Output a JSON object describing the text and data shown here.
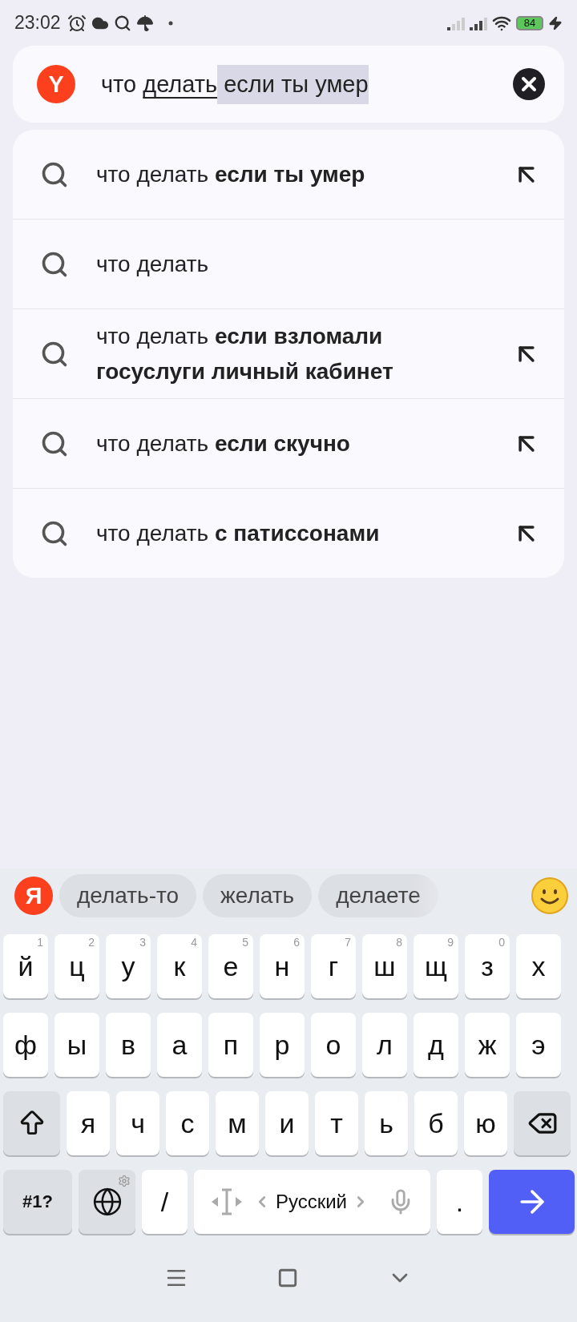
{
  "status_bar": {
    "time": "23:02",
    "battery": "84",
    "charging": true
  },
  "search": {
    "logo": "Y",
    "segments": [
      {
        "text": "что ",
        "underlined": false,
        "highlighted": false
      },
      {
        "text": "делать",
        "underlined": true,
        "highlighted": false
      },
      {
        "text": " если ты умер",
        "underlined": false,
        "highlighted": true
      }
    ]
  },
  "suggestions": [
    {
      "text": "что делать **если ты умер**",
      "insert_arrow": true
    },
    {
      "text": "что делать",
      "insert_arrow": false
    },
    {
      "text": "что делать **если взломали госуслуги личный кабинет**",
      "insert_arrow": true
    },
    {
      "text": "что делать **если скучно**",
      "insert_arrow": true
    },
    {
      "text": "что делать **с патиссонами**",
      "insert_arrow": true
    }
  ],
  "keyboard": {
    "logo": "Я",
    "candidates": [
      "делать-то",
      "желать",
      "делаете"
    ],
    "rows": [
      [
        {
          "kind": "letter",
          "label": "й",
          "hint": "1"
        },
        {
          "kind": "letter",
          "label": "ц",
          "hint": "2"
        },
        {
          "kind": "letter",
          "label": "у",
          "hint": "3"
        },
        {
          "kind": "letter",
          "label": "к",
          "hint": "4"
        },
        {
          "kind": "letter",
          "label": "е",
          "hint": "5"
        },
        {
          "kind": "letter",
          "label": "н",
          "hint": "6"
        },
        {
          "kind": "letter",
          "label": "г",
          "hint": "7"
        },
        {
          "kind": "letter",
          "label": "ш",
          "hint": "8"
        },
        {
          "kind": "letter",
          "label": "щ",
          "hint": "9"
        },
        {
          "kind": "letter",
          "label": "з",
          "hint": "0"
        },
        {
          "kind": "letter",
          "label": "х"
        }
      ],
      [
        {
          "kind": "letter",
          "label": "ф"
        },
        {
          "kind": "letter",
          "label": "ы"
        },
        {
          "kind": "letter",
          "label": "в"
        },
        {
          "kind": "letter",
          "label": "а"
        },
        {
          "kind": "letter",
          "label": "п"
        },
        {
          "kind": "letter",
          "label": "р"
        },
        {
          "kind": "letter",
          "label": "о"
        },
        {
          "kind": "letter",
          "label": "л"
        },
        {
          "kind": "letter",
          "label": "д"
        },
        {
          "kind": "letter",
          "label": "ж"
        },
        {
          "kind": "letter",
          "label": "э"
        }
      ],
      [
        {
          "kind": "shift"
        },
        {
          "kind": "letter",
          "label": "я"
        },
        {
          "kind": "letter",
          "label": "ч"
        },
        {
          "kind": "letter",
          "label": "с"
        },
        {
          "kind": "letter",
          "label": "м"
        },
        {
          "kind": "letter",
          "label": "и"
        },
        {
          "kind": "letter",
          "label": "т"
        },
        {
          "kind": "letter",
          "label": "ь"
        },
        {
          "kind": "letter",
          "label": "б"
        },
        {
          "kind": "letter",
          "label": "ю"
        },
        {
          "kind": "backspace"
        }
      ]
    ],
    "bottom_row": {
      "symbols": "#1?",
      "slash": "/",
      "space": "Русский",
      "period": "."
    }
  }
}
